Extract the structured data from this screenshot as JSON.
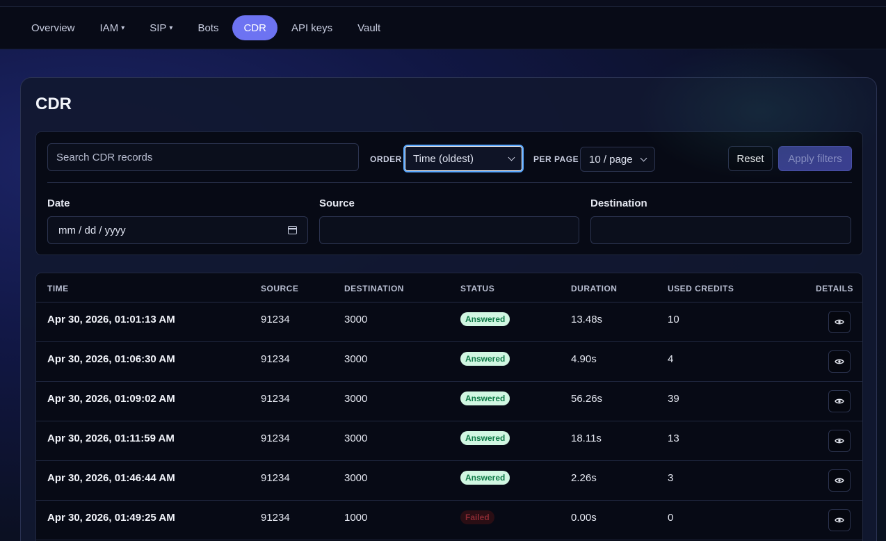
{
  "nav": {
    "items": [
      {
        "label": "Overview",
        "caret": false,
        "active": false
      },
      {
        "label": "IAM",
        "caret": true,
        "active": false
      },
      {
        "label": "SIP",
        "caret": true,
        "active": false
      },
      {
        "label": "Bots",
        "caret": false,
        "active": false
      },
      {
        "label": "CDR",
        "caret": false,
        "active": true
      },
      {
        "label": "API keys",
        "caret": false,
        "active": false
      },
      {
        "label": "Vault",
        "caret": false,
        "active": false
      }
    ],
    "caret_glyph": "▾"
  },
  "page": {
    "title": "CDR"
  },
  "filters": {
    "search_placeholder": "Search CDR records",
    "order_label": "ORDER",
    "order_value": "Time (oldest)",
    "per_page_label": "PER PAGE",
    "per_page_value": "10 / page",
    "reset_label": "Reset",
    "apply_label": "Apply filters",
    "date_label": "Date",
    "date_placeholder": "mm / dd / yyyy",
    "source_label": "Source",
    "destination_label": "Destination"
  },
  "table": {
    "headers": {
      "time": "TIME",
      "source": "SOURCE",
      "destination": "DESTINATION",
      "status": "STATUS",
      "duration": "DURATION",
      "credits": "USED CREDITS",
      "details": "DETAILS"
    },
    "rows": [
      {
        "time": "Apr 30, 2026, 01:01:13 AM",
        "source": "91234",
        "destination": "3000",
        "status": "Answered",
        "status_type": "answered",
        "duration": "13.48s",
        "credits": "10"
      },
      {
        "time": "Apr 30, 2026, 01:06:30 AM",
        "source": "91234",
        "destination": "3000",
        "status": "Answered",
        "status_type": "answered",
        "duration": "4.90s",
        "credits": "4"
      },
      {
        "time": "Apr 30, 2026, 01:09:02 AM",
        "source": "91234",
        "destination": "3000",
        "status": "Answered",
        "status_type": "answered",
        "duration": "56.26s",
        "credits": "39"
      },
      {
        "time": "Apr 30, 2026, 01:11:59 AM",
        "source": "91234",
        "destination": "3000",
        "status": "Answered",
        "status_type": "answered",
        "duration": "18.11s",
        "credits": "13"
      },
      {
        "time": "Apr 30, 2026, 01:46:44 AM",
        "source": "91234",
        "destination": "3000",
        "status": "Answered",
        "status_type": "answered",
        "duration": "2.26s",
        "credits": "3"
      },
      {
        "time": "Apr 30, 2026, 01:49:25 AM",
        "source": "91234",
        "destination": "1000",
        "status": "Failed",
        "status_type": "failed",
        "duration": "0.00s",
        "credits": "0"
      }
    ]
  },
  "colors": {
    "accent": "#6d73f2",
    "answered_bg": "#d1f7e2",
    "answered_fg": "#0f7a47",
    "failed_bg": "#2a0e14",
    "failed_fg": "#8a2a33"
  },
  "icons": {
    "calendar": "calendar-icon",
    "details": "eye-icon",
    "select": "chevron-down-icon"
  }
}
